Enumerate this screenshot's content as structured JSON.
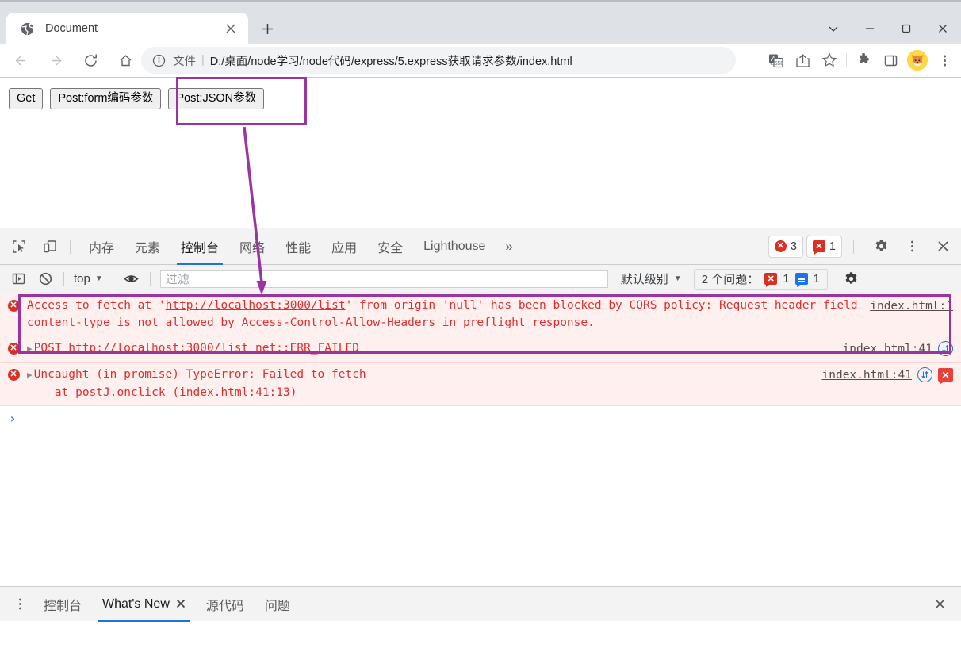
{
  "browser": {
    "tab": {
      "title": "Document",
      "favicon_icon": "globe-icon",
      "close_icon": "close-icon"
    },
    "new_tab_label": "+",
    "window_controls": [
      {
        "name": "minimize-tabstrip",
        "glyph": "⌄"
      },
      {
        "name": "minimize",
        "glyph": "—"
      },
      {
        "name": "maximize",
        "glyph": "□"
      },
      {
        "name": "close",
        "glyph": "✕"
      }
    ],
    "nav": {
      "back_icon": "back-arrow-icon",
      "forward_icon": "forward-arrow-icon",
      "reload_icon": "reload-icon",
      "home_icon": "home-icon"
    },
    "omnibox": {
      "info_icon": "page-info-icon",
      "scheme_label": "文件",
      "separator": "|",
      "url": "D:/桌面/node学习/node代码/express/5.express获取请求参数/index.html"
    },
    "toolbar_icons": [
      {
        "name": "translate-icon",
        "glyph": "文A"
      },
      {
        "name": "share-icon",
        "glyph": "⤴"
      },
      {
        "name": "bookmark-star-icon",
        "glyph": "☆"
      },
      {
        "name": "extensions-puzzle-icon",
        "glyph": "❖"
      },
      {
        "name": "side-panel-icon",
        "glyph": "▭"
      },
      {
        "name": "profile-avatar",
        "glyph": "🐕"
      },
      {
        "name": "chrome-menu-icon",
        "glyph": "⋮"
      }
    ]
  },
  "page": {
    "buttons": [
      {
        "name": "get-button",
        "label": "Get"
      },
      {
        "name": "post-form-button",
        "label": "Post:form编码参数"
      },
      {
        "name": "post-json-button",
        "label": "Post:JSON参数"
      }
    ]
  },
  "devtools": {
    "left_icons": [
      {
        "name": "inspect-element-icon",
        "glyph": "⬚"
      },
      {
        "name": "device-toolbar-icon",
        "glyph": "▭"
      }
    ],
    "tabs": [
      {
        "name": "tab-memory",
        "label": "内存",
        "active": false
      },
      {
        "name": "tab-elements",
        "label": "元素",
        "active": false
      },
      {
        "name": "tab-console",
        "label": "控制台",
        "active": true
      },
      {
        "name": "tab-network",
        "label": "网络",
        "active": false
      },
      {
        "name": "tab-performance",
        "label": "性能",
        "active": false
      },
      {
        "name": "tab-application",
        "label": "应用",
        "active": false
      },
      {
        "name": "tab-security",
        "label": "安全",
        "active": false
      },
      {
        "name": "tab-lighthouse",
        "label": "Lighthouse",
        "active": false
      }
    ],
    "overflow_label": "»",
    "error_count": "3",
    "issue_count": "1",
    "error_badge_glyph": "✕",
    "issue_badge_glyph": "✕",
    "settings_icon": "gear-icon",
    "more_icon": "kebab-menu-icon",
    "close_icon": "close-icon",
    "console_toolbar": {
      "sidebar_icon": "console-sidebar-icon",
      "clear_icon": "clear-console-icon",
      "context_label": "top",
      "context_caret": "▼",
      "eye_icon": "live-expression-icon",
      "filter_placeholder": "过滤",
      "levels_label": "默认级别",
      "levels_caret": "▼",
      "issues_label": "2 个问题：",
      "issues_error_count": "1",
      "issues_info_count": "1",
      "settings_icon": "gear-icon"
    },
    "messages": [
      {
        "name": "console-message-cors",
        "icon": "error-icon",
        "disclosure": "",
        "text_parts": [
          {
            "t": "Access to fetch at '",
            "link": false
          },
          {
            "t": "http://localhost:3000/list",
            "link": true
          },
          {
            "t": "' from origin 'null' has been blocked by CORS policy: Request header field content-type is not allowed by Access-Control-Allow-Headers in preflight response.",
            "link": false
          }
        ],
        "source": "index.html:1",
        "has_net_icon": false,
        "has_err_icon": false
      },
      {
        "name": "console-message-post-failed",
        "icon": "error-icon",
        "disclosure": "▶",
        "text_parts": [
          {
            "t": "POST ",
            "link": false
          },
          {
            "t": "http://localhost:3000/list",
            "link": true
          },
          {
            "t": " net::ERR_FAILED",
            "link": false
          }
        ],
        "source": "index.html:41",
        "has_net_icon": true,
        "has_err_icon": false
      },
      {
        "name": "console-message-typeerror",
        "icon": "error-icon",
        "disclosure": "▶",
        "text_parts": [
          {
            "t": "Uncaught (in promise) TypeError: Failed to fetch\n    at postJ.onclick (",
            "link": false
          },
          {
            "t": "index.html:41:13",
            "link": true
          },
          {
            "t": ")",
            "link": false
          }
        ],
        "source": "index.html:41",
        "has_net_icon": true,
        "has_err_icon": true
      }
    ],
    "prompt_caret": "›"
  },
  "drawer": {
    "kebab_icon": "kebab-menu-icon",
    "tabs": [
      {
        "name": "drawer-tab-console",
        "label": "控制台",
        "active": false,
        "closable": false
      },
      {
        "name": "drawer-tab-whats-new",
        "label": "What's New",
        "active": true,
        "closable": true
      },
      {
        "name": "drawer-tab-sources",
        "label": "源代码",
        "active": false,
        "closable": false
      },
      {
        "name": "drawer-tab-issues",
        "label": "问题",
        "active": false,
        "closable": false
      }
    ],
    "close_icon": "close-icon",
    "close_glyph": "✕"
  },
  "annotations": {
    "accent_color": "#9c34a0",
    "box_button_target": "post-json-button",
    "box_error_target": "console-message-cors"
  }
}
